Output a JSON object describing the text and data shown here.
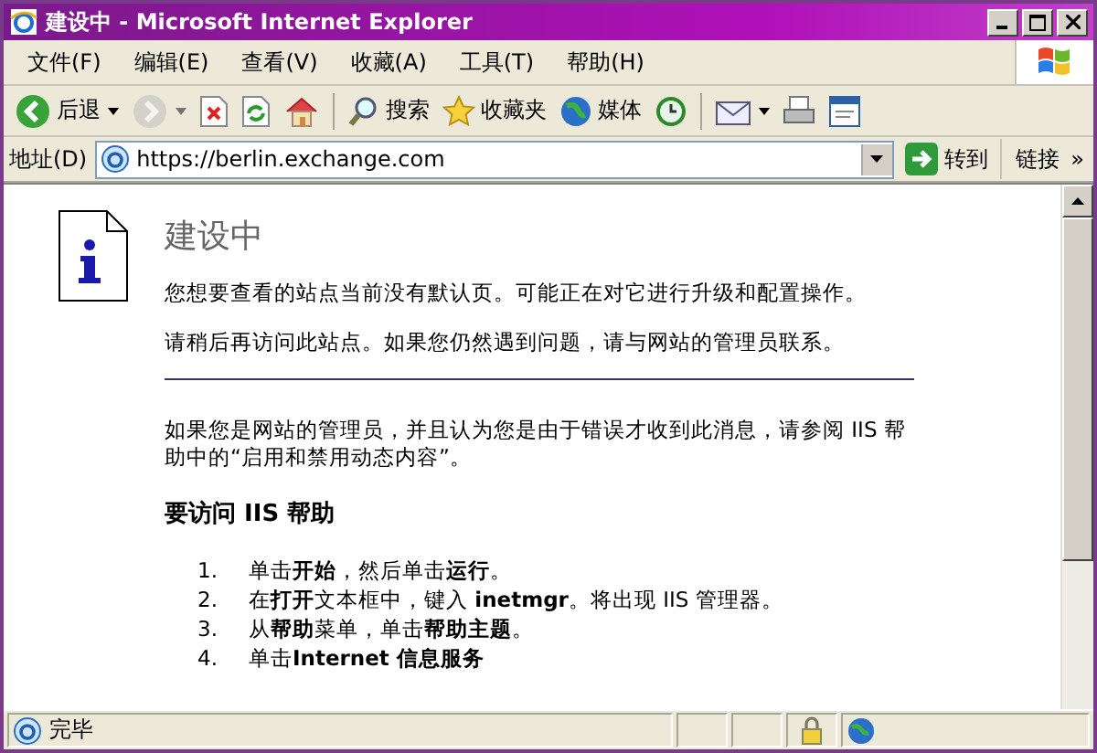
{
  "window": {
    "title": "建设中 - Microsoft Internet Explorer"
  },
  "menu": [
    {
      "label": "文件(F)"
    },
    {
      "label": "编辑(E)"
    },
    {
      "label": "查看(V)"
    },
    {
      "label": "收藏(A)"
    },
    {
      "label": "工具(T)"
    },
    {
      "label": "帮助(H)"
    }
  ],
  "toolbar": [
    {
      "kind": "back",
      "label": "后退",
      "disabled": false,
      "dropdown": true
    },
    {
      "kind": "forward",
      "disabled": true,
      "dropdown": true
    },
    {
      "kind": "stop",
      "disabled": false,
      "dropdown": false
    },
    {
      "kind": "refresh",
      "disabled": false,
      "dropdown": false
    },
    {
      "kind": "home",
      "disabled": false,
      "dropdown": false
    },
    {
      "kind": "search",
      "label": "搜索",
      "disabled": false,
      "dropdown": false
    },
    {
      "kind": "favorites",
      "label": "收藏夹",
      "disabled": false,
      "dropdown": false
    },
    {
      "kind": "media",
      "label": "媒体",
      "disabled": false,
      "dropdown": false
    },
    {
      "kind": "history",
      "disabled": false,
      "dropdown": false
    },
    {
      "kind": "mail",
      "disabled": false,
      "dropdown": true
    },
    {
      "kind": "print",
      "disabled": false,
      "dropdown": false
    },
    {
      "kind": "edit",
      "disabled": false,
      "dropdown": false
    }
  ],
  "address": {
    "label": "地址(D)",
    "value": "https://berlin.exchange.com",
    "go": "转到",
    "links": "链接",
    "more": "»"
  },
  "page": {
    "heading": "建设中",
    "paragraphs": [
      "您想要查看的站点当前没有默认页。可能正在对它进行升级和配置操作。",
      "请稍后再访问此站点。如果您仍然遇到问题，请与网站的管理员联系。"
    ],
    "notice": "如果您是网站的管理员，并且认为您是由于错误才收到此消息，请参阅 IIS 帮助中的“启用和禁用动态内容”。",
    "help_heading": "要访问 IIS 帮助",
    "steps": [
      {
        "number": "1.",
        "text": "单击**开始**，然后单击**运行**。"
      },
      {
        "number": "2.",
        "text": "在**打开**文本框中，键入 **inetmgr**。将出现 IIS 管理器。"
      },
      {
        "number": "3.",
        "text": "从**帮助**菜单，单击**帮助主题**。"
      },
      {
        "number": "4.",
        "text": "单击**Internet 信息服务**"
      }
    ]
  },
  "status_bar": {
    "text": "完毕"
  }
}
